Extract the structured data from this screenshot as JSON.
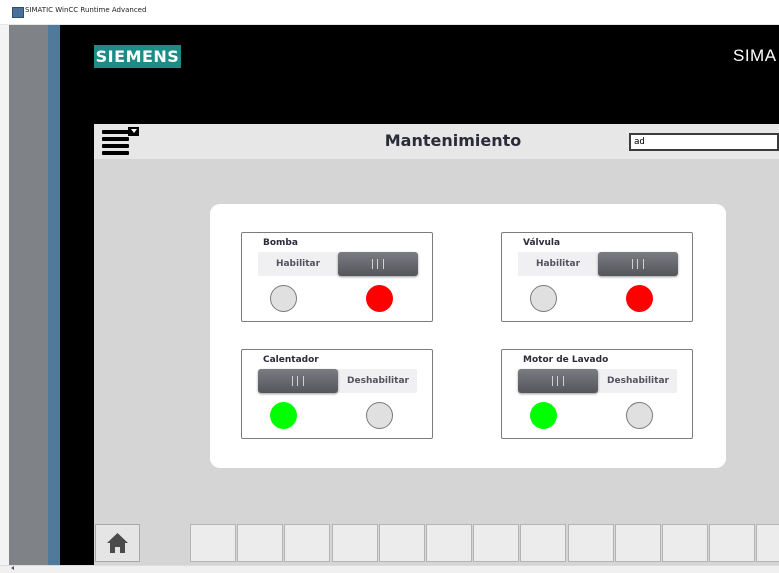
{
  "window": {
    "title": "SIMATIC WinCC Runtime Advanced"
  },
  "header": {
    "logo": "SIEMENS",
    "brand": "SIMA"
  },
  "toolbar": {
    "page_title": "Mantenimiento",
    "user_field_value": "ad"
  },
  "groups": {
    "bomba": {
      "label": "Bomba",
      "switch_text": "Habilitar",
      "switch_state": "on",
      "lamp_left": "gray",
      "lamp_right": "red"
    },
    "valvula": {
      "label": "Válvula",
      "switch_text": "Habilitar",
      "switch_state": "on",
      "lamp_left": "gray",
      "lamp_right": "red"
    },
    "calentador": {
      "label": "Calentador",
      "switch_text": "Deshabilitar",
      "switch_state": "off",
      "lamp_left": "green",
      "lamp_right": "gray"
    },
    "motor": {
      "label": "Motor de Lavado",
      "switch_text": "Deshabilitar",
      "switch_state": "off",
      "lamp_left": "green",
      "lamp_right": "gray"
    }
  },
  "colors": {
    "brand": "#1d8c86",
    "lamp_red": "#ff0000",
    "lamp_green": "#00ff00",
    "lamp_gray": "#e0e0e0",
    "header_bg": "#e7e7e7",
    "content_bg": "#d5d5d5"
  },
  "icons": {
    "menu": "menu-icon",
    "home": "home-icon",
    "app": "app-icon"
  },
  "function_keys_count": 13
}
